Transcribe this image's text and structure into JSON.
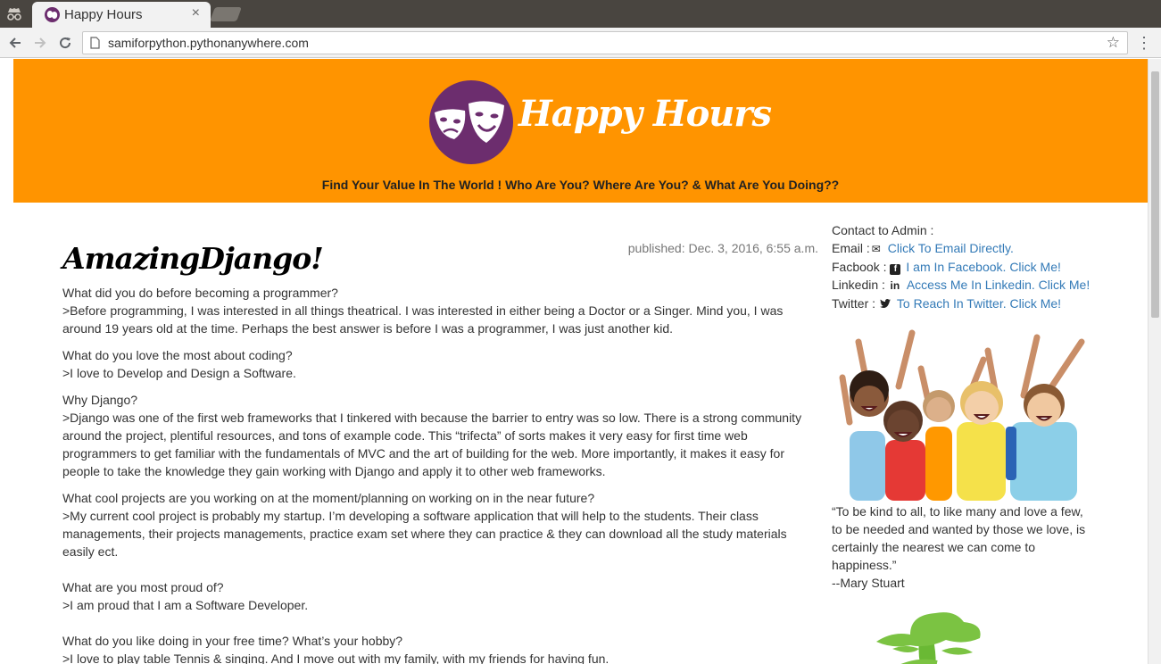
{
  "browser": {
    "tab_title": "Happy Hours",
    "tab_close": "×",
    "url": "samiforpython.pythonanywhere.com"
  },
  "header": {
    "site_title": "Happy Hours",
    "tagline": "Find Your Value In The World ! Who Are You? Where Are You? & What Are You Doing??"
  },
  "post": {
    "title": "AmazingDjango!",
    "published": "published: Dec. 3, 2016, 6:55 a.m.",
    "paragraphs": [
      "What did you do before becoming a programmer?",
      ">Before programming, I was interested in all things theatrical. I was interested in either being a Doctor or a Singer. Mind you, I was around 19 years old at the time. Perhaps the best answer is before I was a programmer, I was just another kid.",
      "What do you love the most about coding?",
      ">I love to Develop and Design a Software.",
      "Why Django?",
      ">Django was one of the first web frameworks that I tinkered with because the barrier to entry was so low. There is a strong community around the project, plentiful resources, and tons of example code. This “trifecta” of sorts makes it very easy for first time web programmers to get familiar with the fundamentals of MVC and the art of building for the web. More importantly, it makes it easy for people to take the knowledge they gain working with Django and apply it to other web frameworks.",
      "What cool projects are you working on at the moment/planning on working on in the near future?",
      ">My current cool project is probably my startup. I’m developing a software application that will help to the students. Their class managements, their projects managements, practice exam set where they can practice & they can download all the study materials easily ect.",
      "What are you most proud of?",
      ">I am proud that I am a Software Developer.",
      "What do you like doing in your free time? What’s your hobby?",
      ">I love to play table Tennis & singing. And I move out with my family, with my friends for having fun."
    ]
  },
  "sidebar": {
    "contact_heading": "Contact to Admin :",
    "email_label": "Email :",
    "email_link": "Click To Email Directly.",
    "facebook_label": "Facbook :",
    "facebook_link": "I am In Facebook. Click Me!",
    "linkedin_label": "Linkedin :",
    "linkedin_link": "Access Me In Linkedin. Click Me!",
    "twitter_label": "Twitter :",
    "twitter_link": "To Reach In Twitter. Click Me!",
    "quote": "“To be kind to all, to like many and love a few, to be needed and wanted by those we love, is certainly the nearest we can come to happiness.”",
    "quote_author": "--Mary Stuart"
  },
  "colors": {
    "header_bg": "#ff9400",
    "logo_bg": "#6c2d6e",
    "link": "#337ab7"
  },
  "icons": [
    "incognito-icon",
    "theater-masks-icon",
    "close-icon",
    "back-arrow-icon",
    "forward-arrow-icon",
    "reload-icon",
    "page-icon",
    "star-icon",
    "menu-dots-icon",
    "envelope-icon",
    "facebook-icon",
    "linkedin-icon",
    "twitter-icon"
  ]
}
